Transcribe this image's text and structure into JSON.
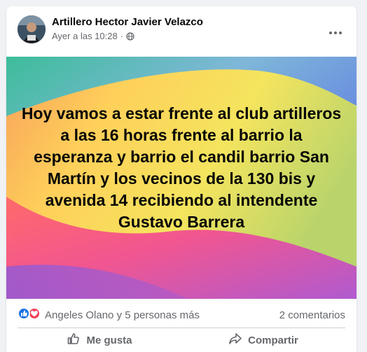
{
  "post": {
    "author": "Artillero Hector Javier Velazco",
    "timestamp": "Ayer a las 10:28",
    "separator": "·",
    "privacy_icon": "globe-icon",
    "more_icon": "more-options-icon",
    "text": "Hoy vamos a estar frente al club artilleros a las 16 horas frente al barrio la esperanza y barrio el candil barrio San Martín y los vecinos de la 130 bis y avenida 14 recibiendo al intendente Gustavo Barrera"
  },
  "reactions": {
    "icons": [
      "like-icon",
      "love-icon"
    ],
    "summary": "Angeles Olano y 5 personas más",
    "comments": "2 comentarios"
  },
  "actions": {
    "like_label": "Me gusta",
    "share_label": "Compartir"
  },
  "colors": {
    "accent": "#1b74e4",
    "love": "#f33e58",
    "muted_text": "#65676b"
  }
}
